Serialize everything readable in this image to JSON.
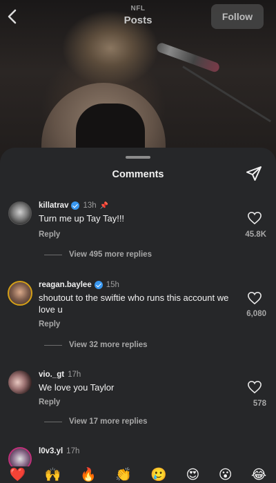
{
  "header": {
    "subtitle": "NFL",
    "title": "Posts",
    "follow_label": "Follow"
  },
  "sheet": {
    "title": "Comments"
  },
  "comments": [
    {
      "username": "killatrav",
      "verified": true,
      "time": "13h",
      "pinned": true,
      "text": "Turn me up Tay Tay!!!",
      "reply_label": "Reply",
      "likes": "45.8K",
      "view_replies": "View 495 more replies"
    },
    {
      "username": "reagan.baylee",
      "verified": true,
      "time": "15h",
      "pinned": false,
      "text": "shoutout to the swiftie who runs this account we love u",
      "reply_label": "Reply",
      "likes": "6,080",
      "view_replies": "View 32 more replies"
    },
    {
      "username": "vio._gt",
      "verified": false,
      "time": "17h",
      "pinned": false,
      "text": "We love you Taylor",
      "reply_label": "Reply",
      "likes": "578",
      "view_replies": "View 17 more replies"
    },
    {
      "username": "l0v3.yl",
      "verified": false,
      "time": "17h",
      "pinned": false,
      "text": "",
      "reply_label": "",
      "likes": "",
      "view_replies": ""
    }
  ],
  "emoji_bar": [
    "❤️",
    "🙌",
    "🔥",
    "👏",
    "🥲",
    "😍",
    "😮",
    "😂"
  ],
  "icons": {
    "back": "chevron-left-icon",
    "share": "paper-plane-icon",
    "like": "heart-outline-icon",
    "pin": "pin-icon",
    "verified": "verified-badge-icon"
  },
  "colors": {
    "sheet_bg": "#262729",
    "verified_blue": "#3897f0",
    "muted_text": "#a8a8a8"
  }
}
